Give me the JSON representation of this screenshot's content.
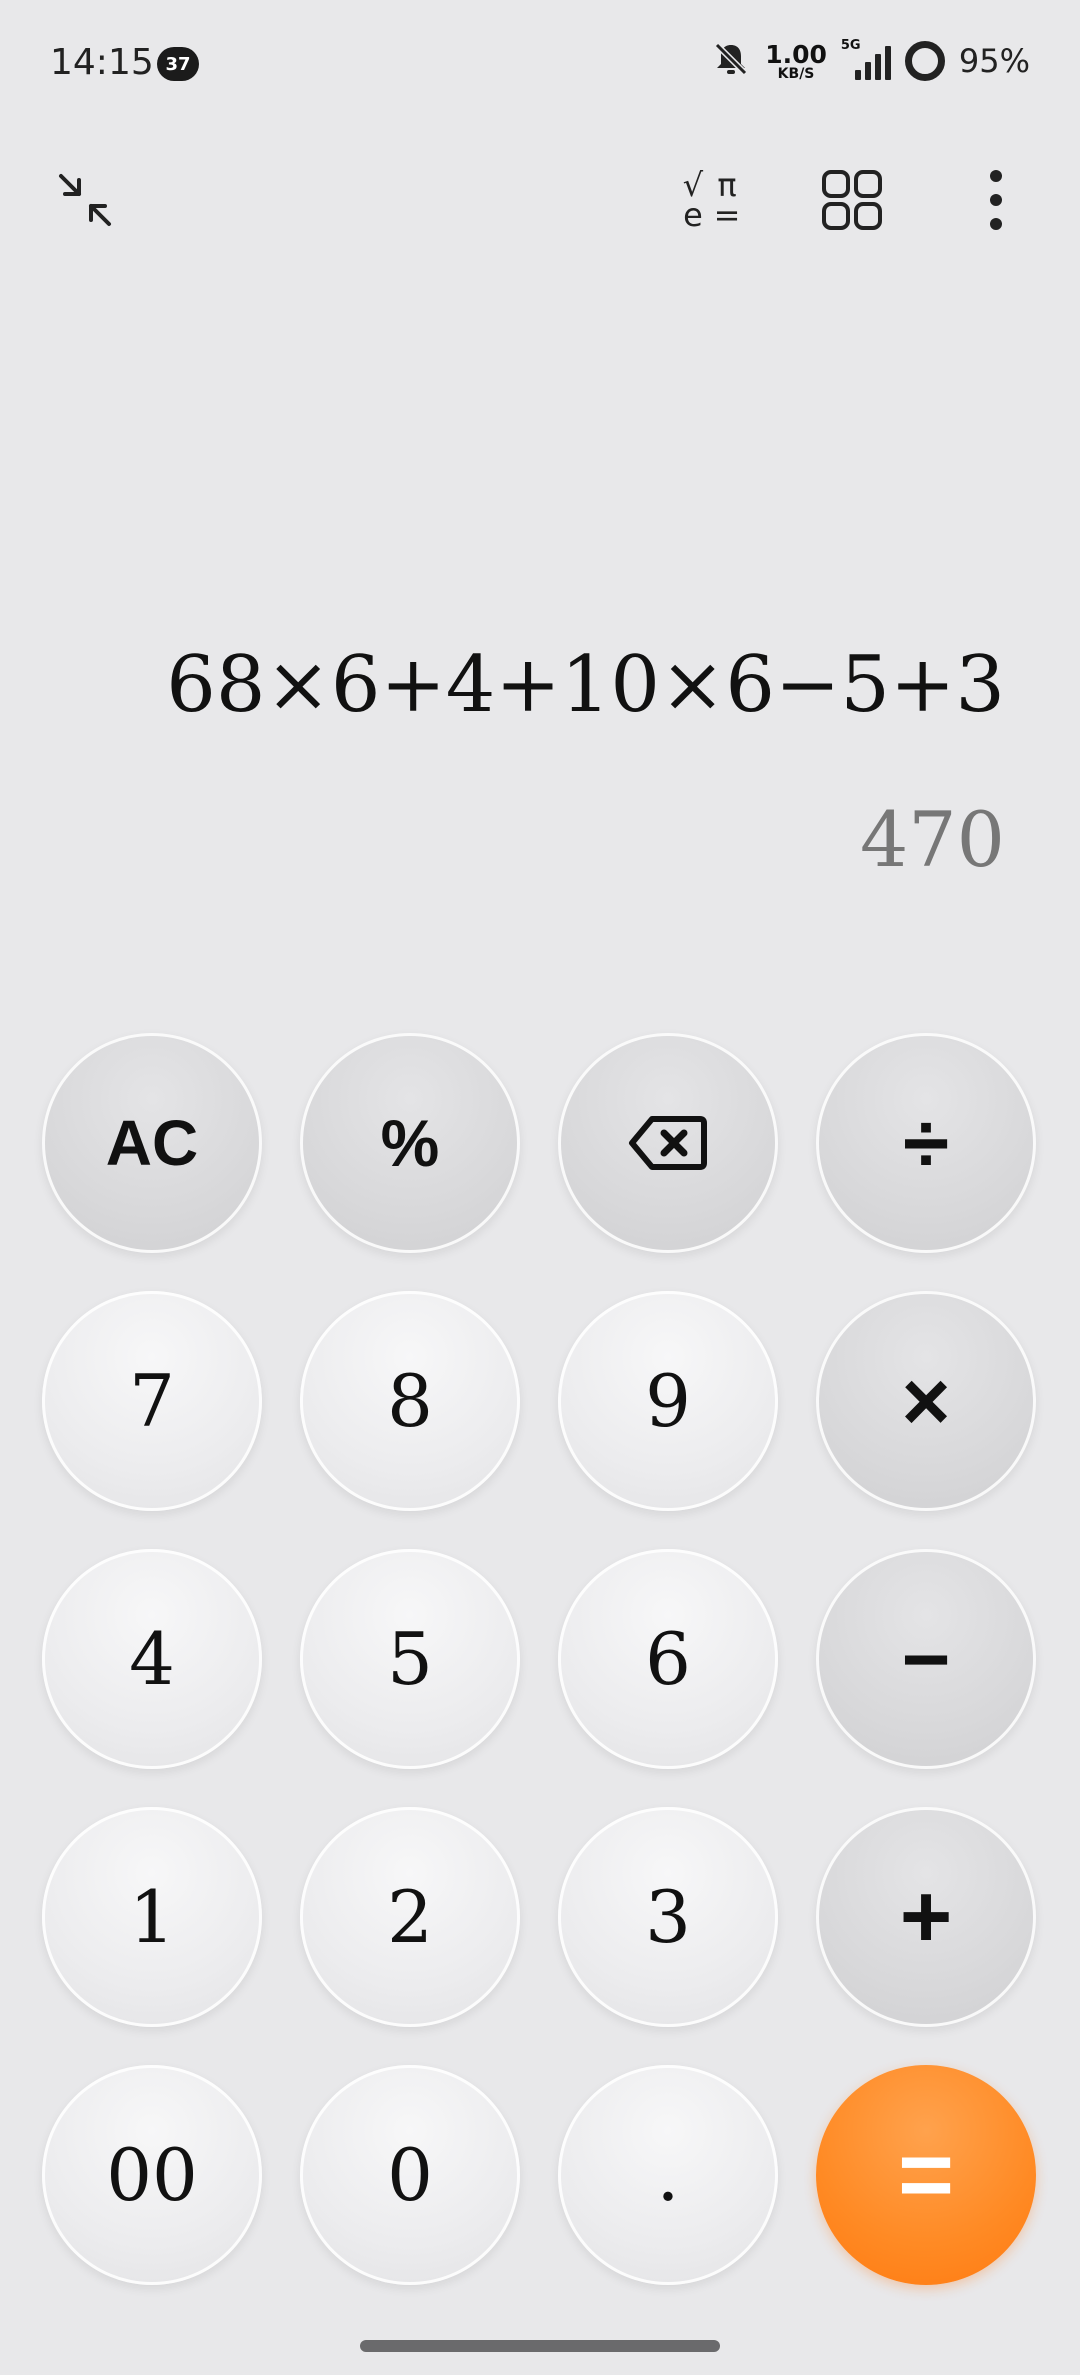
{
  "status_bar": {
    "time": "14:15",
    "badge": "37",
    "net_speed_value": "1.00",
    "net_speed_unit": "KB/S",
    "network_type": "5G",
    "battery": "95%"
  },
  "toolbar": {
    "icons": [
      "collapse-icon",
      "scientific-mode-icon",
      "apps-grid-icon",
      "more-options-icon"
    ],
    "sci_glyphs": [
      "√",
      "π",
      "e",
      "="
    ]
  },
  "display": {
    "expression": "68×6+4+10×6−5+3",
    "result": "470"
  },
  "keypad": {
    "rows": [
      [
        "AC",
        "%",
        "⌫",
        "÷"
      ],
      [
        "7",
        "8",
        "9",
        "×"
      ],
      [
        "4",
        "5",
        "6",
        "−"
      ],
      [
        "1",
        "2",
        "3",
        "+"
      ],
      [
        "00",
        "0",
        ".",
        "="
      ]
    ]
  },
  "colors": {
    "background": "#e8e8ea",
    "accent_equals": "#ff8a24",
    "result_text": "#777777"
  }
}
